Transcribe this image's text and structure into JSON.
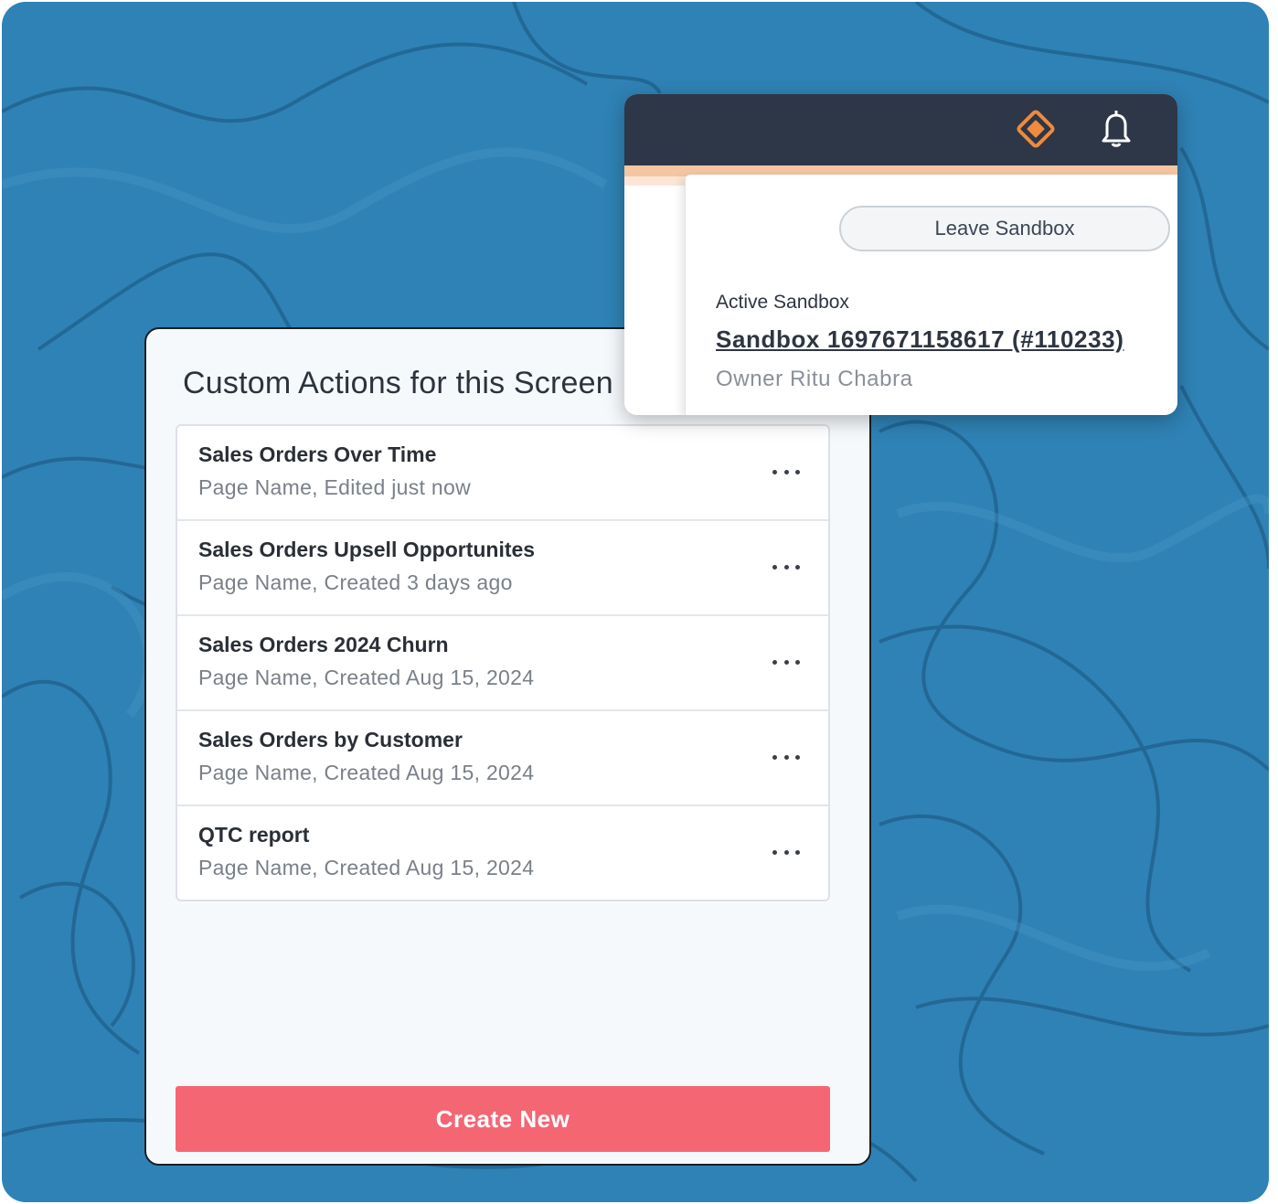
{
  "colors": {
    "background": "#2f82b5",
    "header": "#2d3747",
    "accent_bar": "#f6c5a1",
    "primary_button": "#f56673",
    "diamond_icon": "#f08a3c"
  },
  "custom_actions": {
    "title": "Custom Actions for this Screen",
    "items": [
      {
        "title": "Sales Orders Over Time",
        "subtitle": "Page Name, Edited just now"
      },
      {
        "title": "Sales Orders Upsell Opportunites",
        "subtitle": "Page Name, Created 3 days ago"
      },
      {
        "title": "Sales Orders 2024 Churn",
        "subtitle": "Page Name, Created Aug 15, 2024"
      },
      {
        "title": "Sales Orders by Customer",
        "subtitle": "Page Name, Created Aug 15, 2024"
      },
      {
        "title": "QTC report",
        "subtitle": "Page Name, Created Aug 15, 2024"
      }
    ],
    "create_label": "Create New"
  },
  "sandbox": {
    "leave_label": "Leave Sandbox",
    "active_label": "Active Sandbox",
    "name": "Sandbox 1697671158617 (#110233)",
    "owner": "Owner Ritu Chabra",
    "header_icons": [
      "diamond-icon",
      "bell-icon"
    ]
  }
}
